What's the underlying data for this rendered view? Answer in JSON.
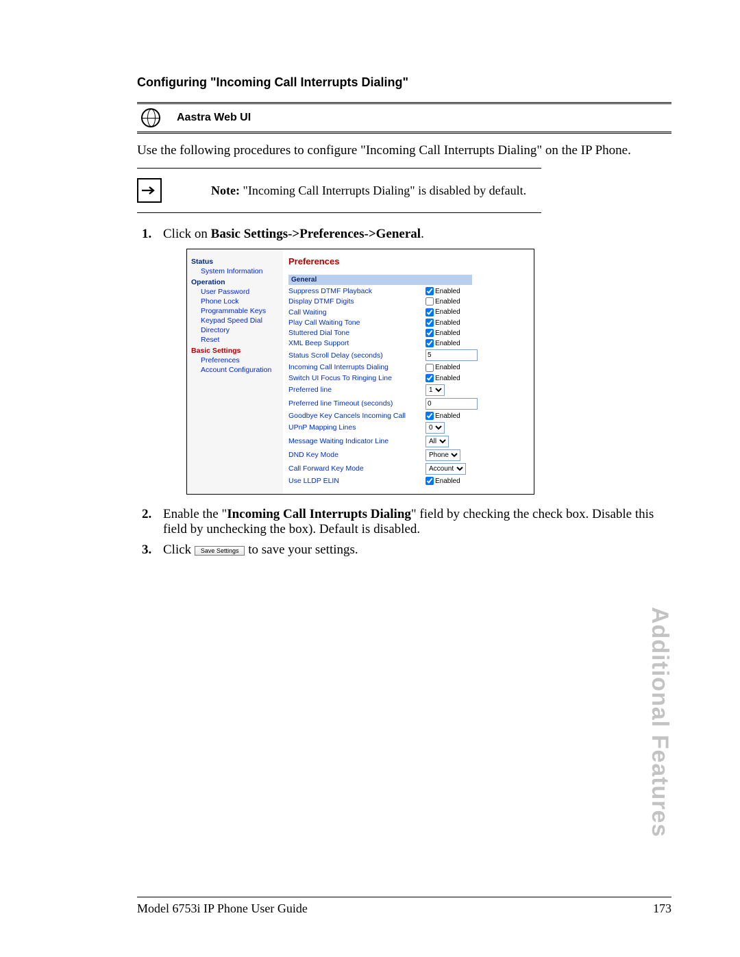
{
  "section_title": "Configuring \"Incoming Call Interrupts Dialing\"",
  "titlebar_label": "Aastra Web UI",
  "intro": "Use the following procedures to configure \"Incoming Call Interrupts Dialing\" on the IP Phone.",
  "note_label": "Note:",
  "note_text": "\"Incoming Call Interrupts Dialing\" is disabled by default.",
  "steps": {
    "s1_prefix": "Click on ",
    "s1_bold": "Basic Settings->Preferences->General",
    "s1_suffix": ".",
    "s2_prefix": "Enable the \"",
    "s2_bold": "Incoming Call Interrupts Dialing",
    "s2_suffix": "\" field by checking the check box. Disable this field by unchecking the box). Default is disabled.",
    "s3_prefix": "Click ",
    "s3_suffix": " to save your settings."
  },
  "save_settings_btn": "Save Settings",
  "thumb_tab": "Additional Features",
  "footer_left": "Model 6753i IP Phone User Guide",
  "footer_right": "173",
  "shot": {
    "sidebar": {
      "cat_status": "Status",
      "status_items": [
        "System Information"
      ],
      "cat_operation": "Operation",
      "operation_items": [
        "User Password",
        "Phone Lock",
        "Programmable Keys",
        "Keypad Speed Dial",
        "Directory",
        "Reset"
      ],
      "cat_basic": "Basic Settings",
      "basic_items": [
        "Preferences",
        "Account Configuration"
      ]
    },
    "main": {
      "header": "Preferences",
      "section": "General",
      "rows": [
        {
          "label": "Suppress DTMF Playback",
          "type": "cb",
          "checked": true,
          "text": "Enabled"
        },
        {
          "label": "Display DTMF Digits",
          "type": "cb",
          "checked": false,
          "text": "Enabled"
        },
        {
          "label": "Call Waiting",
          "type": "cb",
          "checked": true,
          "text": "Enabled"
        },
        {
          "label": "Play Call Waiting Tone",
          "type": "cb",
          "checked": true,
          "text": "Enabled"
        },
        {
          "label": "Stuttered Dial Tone",
          "type": "cb",
          "checked": true,
          "text": "Enabled"
        },
        {
          "label": "XML Beep Support",
          "type": "cb",
          "checked": true,
          "text": "Enabled"
        },
        {
          "label": "Status Scroll Delay (seconds)",
          "type": "text",
          "value": "5"
        },
        {
          "label": "Incoming Call Interrupts Dialing",
          "type": "cb",
          "checked": false,
          "text": "Enabled"
        },
        {
          "label": "Switch UI Focus To Ringing Line",
          "type": "cb",
          "checked": true,
          "text": "Enabled"
        },
        {
          "label": "Preferred line",
          "type": "select",
          "value": "1"
        },
        {
          "label": "Preferred line Timeout (seconds)",
          "type": "text",
          "value": "0"
        },
        {
          "label": "Goodbye Key Cancels Incoming Call",
          "type": "cb",
          "checked": true,
          "text": "Enabled"
        },
        {
          "label": "UPnP Mapping Lines",
          "type": "select",
          "value": "0"
        },
        {
          "label": "Message Waiting Indicator Line",
          "type": "select",
          "value": "All"
        },
        {
          "label": "DND Key Mode",
          "type": "select",
          "value": "Phone"
        },
        {
          "label": "Call Forward Key Mode",
          "type": "select",
          "value": "Account"
        },
        {
          "label": "Use LLDP ELIN",
          "type": "cb",
          "checked": true,
          "text": "Enabled"
        }
      ]
    }
  }
}
